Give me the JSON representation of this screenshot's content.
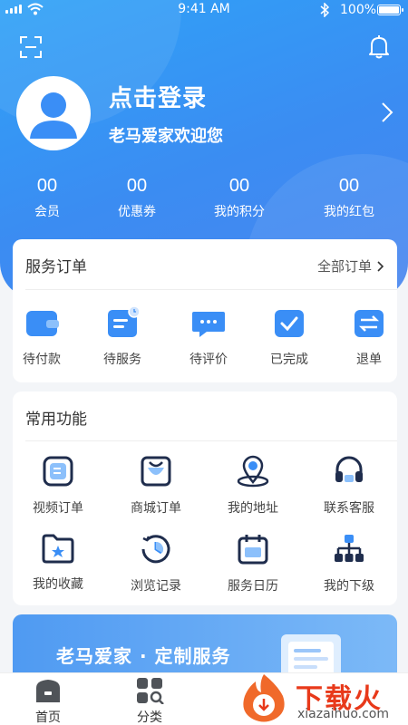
{
  "status_bar": {
    "time": "9:41 AM",
    "battery": "100%"
  },
  "profile": {
    "login_title": "点击登录",
    "welcome": "老马爱家欢迎您"
  },
  "stats": [
    {
      "value": "00",
      "label": "会员"
    },
    {
      "value": "00",
      "label": "优惠券"
    },
    {
      "value": "00",
      "label": "我的积分"
    },
    {
      "value": "00",
      "label": "我的红包"
    }
  ],
  "orders": {
    "title": "服务订单",
    "all_label": "全部订单",
    "items": [
      {
        "label": "待付款",
        "icon": "wallet-icon"
      },
      {
        "label": "待服务",
        "icon": "clipboard-clock-icon"
      },
      {
        "label": "待评价",
        "icon": "chat-bubble-icon"
      },
      {
        "label": "已完成",
        "icon": "check-box-icon"
      },
      {
        "label": "退单",
        "icon": "swap-arrows-icon"
      }
    ]
  },
  "functions": {
    "title": "常用功能",
    "items": [
      {
        "label": "视频订单",
        "icon": "video-order-icon"
      },
      {
        "label": "商城订单",
        "icon": "shopping-bag-icon"
      },
      {
        "label": "我的地址",
        "icon": "location-pin-icon"
      },
      {
        "label": "联系客服",
        "icon": "headset-icon"
      },
      {
        "label": "我的收藏",
        "icon": "star-folder-icon"
      },
      {
        "label": "浏览记录",
        "icon": "history-clock-icon"
      },
      {
        "label": "服务日历",
        "icon": "calendar-icon"
      },
      {
        "label": "我的下级",
        "icon": "org-chart-icon"
      }
    ]
  },
  "banner": {
    "text": "老马爱家 · 定制服务"
  },
  "tabbar": [
    {
      "label": "首页",
      "icon": "home-icon"
    },
    {
      "label": "分类",
      "icon": "category-icon"
    }
  ],
  "watermark": {
    "text": "下载火",
    "url": "xiazaihuo.com"
  },
  "colors": {
    "primary": "#3b8cf2",
    "icon_blue": "#3a8ef6",
    "icon_dark": "#1f2d4d",
    "watermark_red": "#e8391a"
  }
}
